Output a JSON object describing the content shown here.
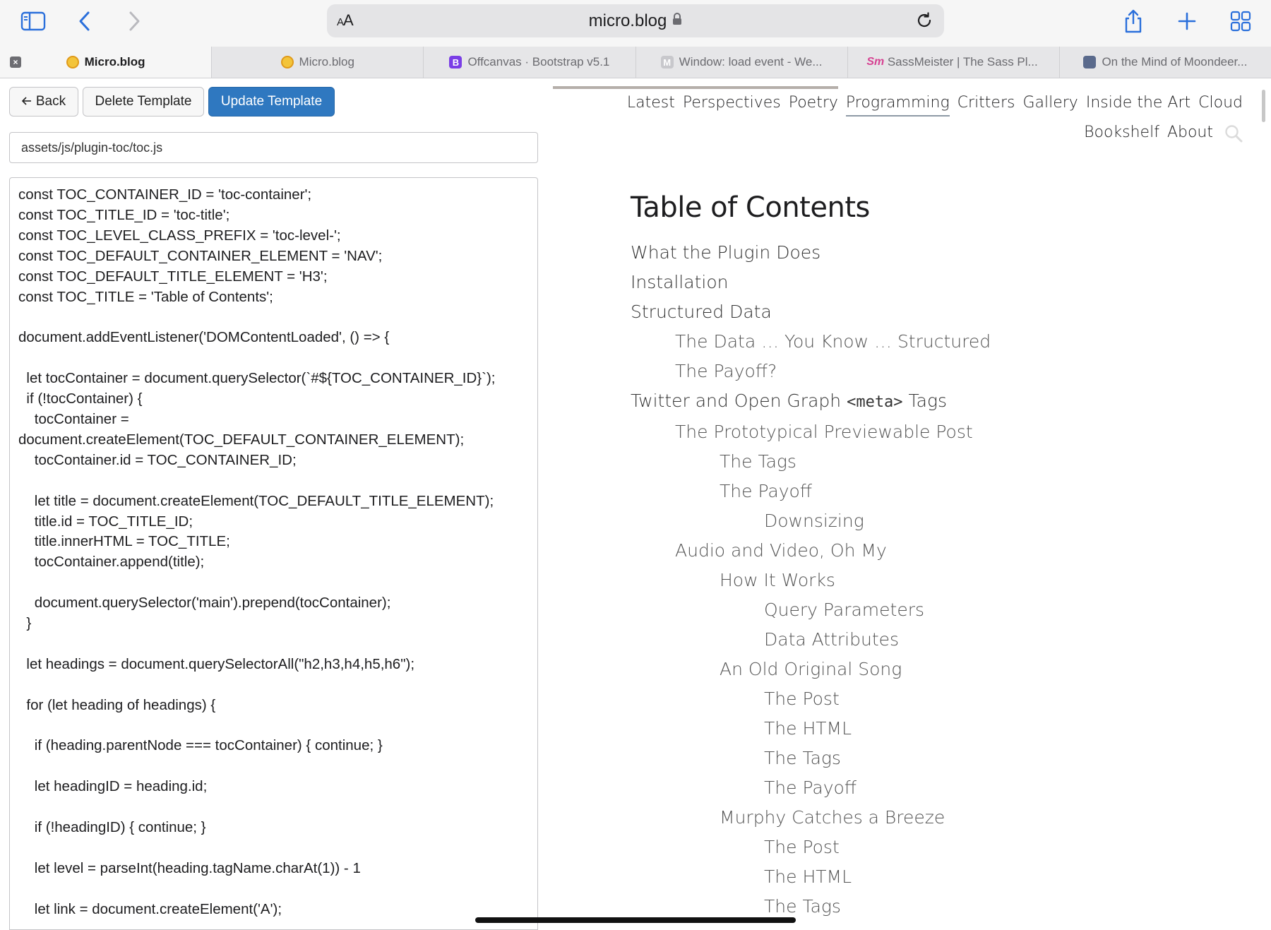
{
  "browser": {
    "text_size_label": "AA",
    "url": "micro.blog",
    "tabs": [
      {
        "title": "Micro.blog",
        "favicon": "microblog-icon",
        "active": true
      },
      {
        "title": "Micro.blog",
        "favicon": "microblog-icon",
        "active": false
      },
      {
        "title": "Offcanvas · Bootstrap v5.1",
        "favicon": "bootstrap-icon",
        "favicon_text": "B",
        "active": false
      },
      {
        "title": "Window: load event - We...",
        "favicon": "mdn-icon",
        "favicon_text": "M",
        "active": false
      },
      {
        "title": "SassMeister | The Sass Pl...",
        "favicon": "sassmeister-icon",
        "favicon_text": "Sm",
        "active": false
      },
      {
        "title": "On the Mind of Moondeer...",
        "favicon": "moondeer-icon",
        "active": false
      }
    ]
  },
  "editor": {
    "back_label": "Back",
    "delete_label": "Delete Template",
    "update_label": "Update Template",
    "path_value": "assets/js/plugin-toc/toc.js",
    "code": "const TOC_CONTAINER_ID = 'toc-container';\nconst TOC_TITLE_ID = 'toc-title';\nconst TOC_LEVEL_CLASS_PREFIX = 'toc-level-';\nconst TOC_DEFAULT_CONTAINER_ELEMENT = 'NAV';\nconst TOC_DEFAULT_TITLE_ELEMENT = 'H3';\nconst TOC_TITLE = 'Table of Contents';\n\ndocument.addEventListener('DOMContentLoaded', () => {\n\n  let tocContainer = document.querySelector(`#${TOC_CONTAINER_ID}`);\n  if (!tocContainer) {\n    tocContainer =\ndocument.createElement(TOC_DEFAULT_CONTAINER_ELEMENT);\n    tocContainer.id = TOC_CONTAINER_ID;\n\n    let title = document.createElement(TOC_DEFAULT_TITLE_ELEMENT);\n    title.id = TOC_TITLE_ID;\n    title.innerHTML = TOC_TITLE;\n    tocContainer.append(title);\n\n    document.querySelector('main').prepend(tocContainer);\n  }\n\n  let headings = document.querySelectorAll(\"h2,h3,h4,h5,h6\");\n\n  for (let heading of headings) {\n\n    if (heading.parentNode === tocContainer) { continue; }\n\n    let headingID = heading.id;\n\n    if (!headingID) { continue; }\n\n    let level = parseInt(heading.tagName.charAt(1)) - 1\n\n    let link = document.createElement('A');"
  },
  "site": {
    "nav": [
      {
        "label": "Latest",
        "current": false
      },
      {
        "label": "Perspectives",
        "current": false
      },
      {
        "label": "Poetry",
        "current": false
      },
      {
        "label": "Programming",
        "current": true
      },
      {
        "label": "Critters",
        "current": false
      },
      {
        "label": "Gallery",
        "current": false
      },
      {
        "label": "Inside the Art",
        "current": false
      },
      {
        "label": "Cloud",
        "current": false
      },
      {
        "label": "Bookshelf",
        "current": false
      },
      {
        "label": "About",
        "current": false
      }
    ],
    "toc_title": "Table of Contents",
    "toc": [
      {
        "level": 1,
        "text": "What the Plugin Does"
      },
      {
        "level": 1,
        "text": "Installation"
      },
      {
        "level": 1,
        "text": "Structured Data"
      },
      {
        "level": 2,
        "text": "The Data … You Know … Structured"
      },
      {
        "level": 2,
        "text": "The Payoff?"
      },
      {
        "level": 1,
        "text_before": "Twitter and Open Graph ",
        "code": "<meta>",
        "text_after": " Tags"
      },
      {
        "level": 2,
        "text": "The Prototypical Previewable Post"
      },
      {
        "level": 3,
        "text": "The Tags"
      },
      {
        "level": 3,
        "text": "The Payoff"
      },
      {
        "level": 4,
        "text": "Downsizing"
      },
      {
        "level": 2,
        "text": "Audio and Video, Oh My"
      },
      {
        "level": 3,
        "text": "How It Works"
      },
      {
        "level": 4,
        "text": "Query Parameters"
      },
      {
        "level": 4,
        "text": "Data Attributes"
      },
      {
        "level": 3,
        "text": "An Old Original Song"
      },
      {
        "level": 4,
        "text": "The Post"
      },
      {
        "level": 4,
        "text": "The HTML"
      },
      {
        "level": 4,
        "text": "The Tags"
      },
      {
        "level": 4,
        "text": "The Payoff"
      },
      {
        "level": 3,
        "text": "Murphy Catches a Breeze"
      },
      {
        "level": 4,
        "text": "The Post"
      },
      {
        "level": 4,
        "text": "The HTML"
      },
      {
        "level": 4,
        "text": "The Tags"
      }
    ]
  },
  "colors": {
    "primary_button": "#2f78c0",
    "toolbar_bg": "#f6f6f6",
    "tab_bar_bg": "#e6e6e8",
    "accent_icons": "#2a6fdb"
  }
}
